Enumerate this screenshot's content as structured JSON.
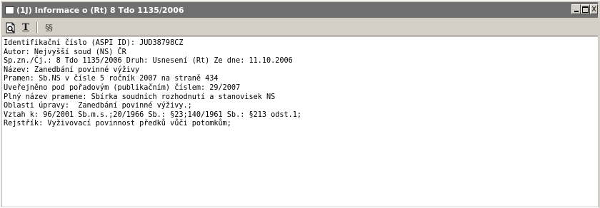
{
  "window": {
    "title": "(1J) Informace o (Rt) 8 Tdo 1135/2006",
    "controls": {
      "minimize": "_",
      "maximize": "□",
      "close": "X"
    }
  },
  "toolbar": {
    "items": [
      {
        "name": "print-preview",
        "icon": "print-preview-icon"
      },
      {
        "name": "text",
        "label": "T"
      },
      {
        "name": "sections",
        "label": "§§"
      }
    ]
  },
  "content": {
    "lines": [
      "Identifikační číslo (ASPI ID): JUD38798CZ",
      "Autor: Nejvyšší soud (NS) ČR",
      "Sp.zn./Čj.: 8 Tdo 1135/2006 Druh: Usnesení (Rt) Ze dne: 11.10.2006",
      "Název: Zanedbání povinné výživy",
      "Pramen: Sb.NS v čísle 5 ročník 2007 na straně 434",
      "Uveřejněno pod pořadovým (publikačním) číslem: 29/2007",
      "Plný název pramene: Sbírka soudních rozhodnutí a stanovisek NS",
      "Oblasti úpravy:  Zanedbání povinné výživy.;",
      "Vztah k: 96/2001 Sb.m.s.;20/1966 Sb.: §23;140/1961 Sb.: §213 odst.1;",
      "Rejstřík: Vyživovací povinnost předků vůči potomkům;"
    ]
  }
}
